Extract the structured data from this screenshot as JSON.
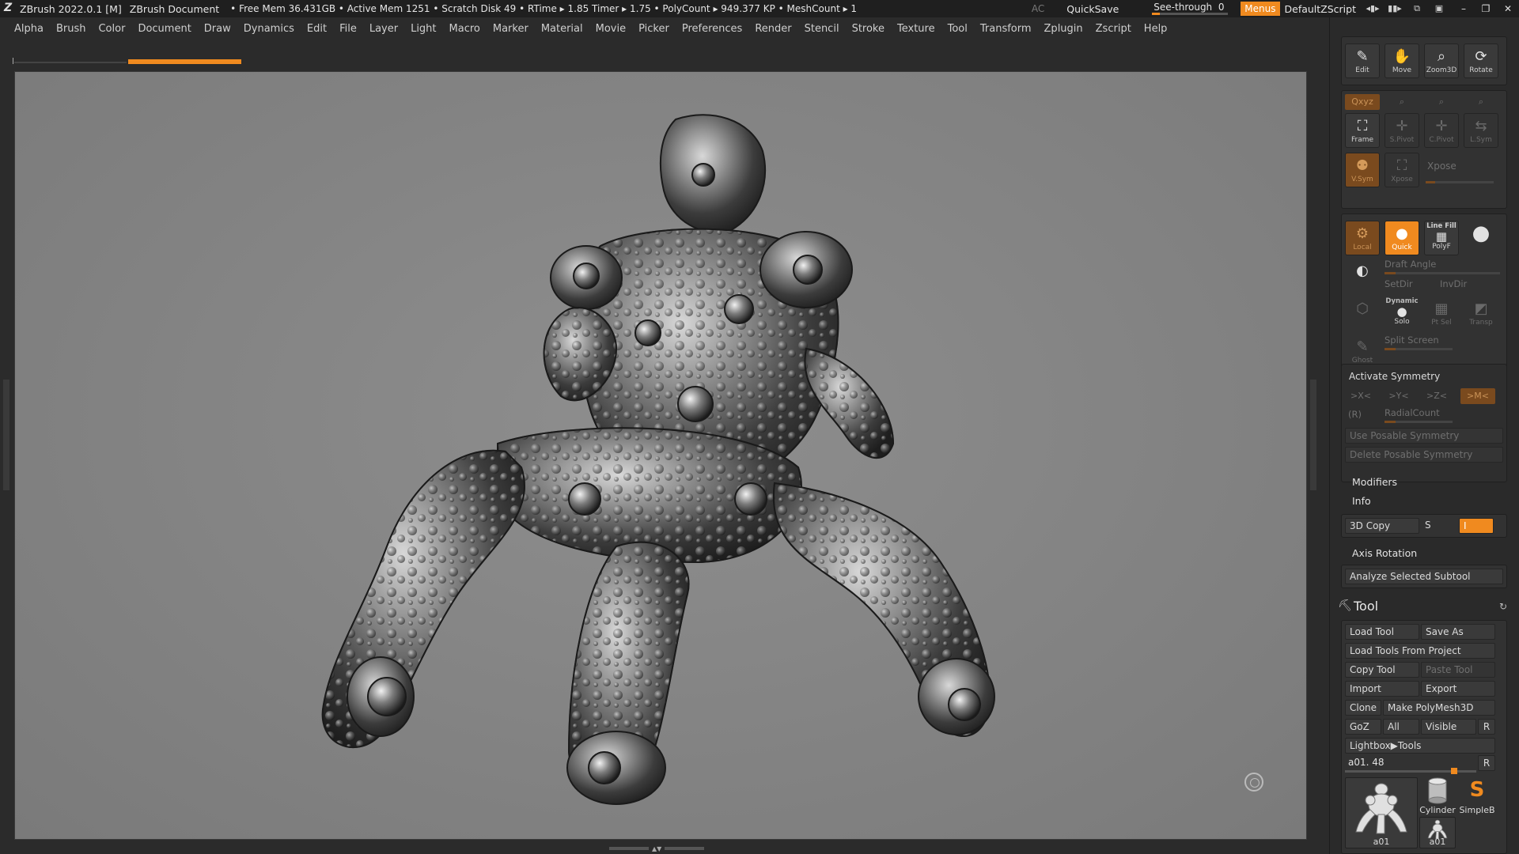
{
  "app": {
    "title": "ZBrush 2022.0.1 [M]",
    "document": "ZBrush Document",
    "stats": "• Free Mem 36.431GB • Active Mem 1251 • Scratch Disk 49 •  RTime ▸ 1.85 Timer ▸ 1.75 • PolyCount ▸ 949.377 KP  • MeshCount ▸ 1",
    "ac": "AC",
    "quicksave": "QuickSave",
    "seethrough_label": "See-through",
    "seethrough_value": "0",
    "seethrough_level": 0,
    "menus": "Menus",
    "script": "DefaultZScript"
  },
  "menu": [
    "Alpha",
    "Brush",
    "Color",
    "Document",
    "Draw",
    "Dynamics",
    "Edit",
    "File",
    "Layer",
    "Light",
    "Macro",
    "Marker",
    "Material",
    "Movie",
    "Picker",
    "Preferences",
    "Render",
    "Stencil",
    "Stroke",
    "Texture",
    "Tool",
    "Transform",
    "Zplugin",
    "Zscript",
    "Help"
  ],
  "colors": {
    "accent": "#f08a1f",
    "accent_dark": "#7a4a1e",
    "panel": "#2a2a2a",
    "viewport": "#858585"
  },
  "shelf": {
    "top_buttons": [
      {
        "label": "Edit",
        "icon": "edit-icon"
      },
      {
        "label": "Move",
        "icon": "move-hand-icon"
      },
      {
        "label": "Zoom3D",
        "icon": "zoom3d-icon"
      },
      {
        "label": "Rotate",
        "icon": "rotate-icon"
      }
    ],
    "axis_buttons": [
      "Qxyz",
      "",
      "",
      ""
    ],
    "pivot_buttons": [
      {
        "label": "Frame",
        "icon": "frame-icon"
      },
      {
        "label": "S.Pivot",
        "icon": "spivot-icon"
      },
      {
        "label": "C.Pivot",
        "icon": "cpivot-icon"
      },
      {
        "label": "L.Sym",
        "icon": "lsym-icon"
      }
    ],
    "vsym_label": "V.Sym",
    "xpose_btn_label": "Xpose",
    "xpose_label": "Xpose",
    "local_label": "Local",
    "quick_label": "Quick",
    "linefill_label": "Line Fill",
    "polyf_label": "PolyF",
    "draft_angle": "Draft Angle",
    "setdir": "SetDir",
    "invdir": "InvDir",
    "dynamic_label": "Dynamic",
    "solo_label": "Solo",
    "ptsel_label": "Pt Sel",
    "transp_label": "Transp",
    "ghost_label": "Ghost",
    "split_screen": "Split Screen"
  },
  "symmetry": {
    "activate": "Activate Symmetry",
    "axes": [
      ">X<",
      ">Y<",
      ">Z<",
      ">M<"
    ],
    "r_label": "(R)",
    "radial": "RadialCount",
    "use_posable": "Use Posable Symmetry",
    "delete_posable": "Delete Posable Symmetry",
    "modifiers": "Modifiers",
    "info": "Info",
    "copy3d": "3D Copy",
    "s_label": "S",
    "i_label": "I",
    "axis_rotation": "Axis Rotation",
    "analyze": "Analyze Selected Subtool"
  },
  "tool": {
    "title": "Tool",
    "load_tool": "Load Tool",
    "save_as": "Save As",
    "load_from_project": "Load Tools From Project",
    "copy_tool": "Copy Tool",
    "paste_tool": "Paste Tool",
    "import": "Import",
    "export": "Export",
    "clone": "Clone",
    "make_polymesh": "Make PolyMesh3D",
    "goz": "GoZ",
    "all": "All",
    "visible": "Visible",
    "r": "R",
    "lightbox": "Lightbox▶Tools",
    "current": "a01. 48",
    "current_r": "R",
    "current_level": 0.85,
    "thumbs": [
      "a01",
      "Cylinder",
      "SimpleB",
      "a01"
    ]
  }
}
